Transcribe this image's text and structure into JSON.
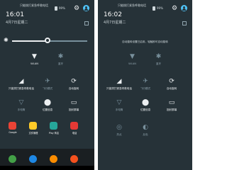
{
  "left": {
    "status_text": "只能拨打紧急呼救电话",
    "battery": "99%",
    "time": "16:01",
    "date": "4月7日星期二",
    "brightness_fraction": 0.47,
    "tiles": [
      {
        "label": "WLAN",
        "icon": "▼",
        "dim": false
      },
      {
        "label": "蓝牙",
        "icon": "✱",
        "dim": true
      },
      {
        "label": "只能拨打紧急呼救电话",
        "icon": "◢",
        "dim": false
      },
      {
        "label": "飞行模式",
        "icon": "✈",
        "dim": true
      },
      {
        "label": "自动旋转",
        "icon": "⟳",
        "dim": false
      },
      {
        "label": "手电筒",
        "icon": "▽",
        "dim": true
      },
      {
        "label": "位置信息",
        "icon": "⬤",
        "dim": false
      },
      {
        "label": "投射屏幕",
        "icon": "▭",
        "dim": false
      }
    ],
    "home_apps": [
      {
        "label": "Google",
        "color": "#ea4335"
      },
      {
        "label": "文件管理",
        "color": "#ffca28"
      },
      {
        "label": "Play 商店",
        "color": "#26a69a"
      },
      {
        "label": "电话",
        "color": "#e53935"
      }
    ],
    "dock": [
      "#43a047",
      "#1e88e5",
      "#fb8c00",
      "#f4511e"
    ]
  },
  "right": {
    "status_text": "只能拨打紧急呼救电话",
    "battery": "99%",
    "time": "16:02",
    "date": "4月7日星期二",
    "notice": "自动旋转设置已启用，轻触即可自动旋转",
    "tiles": [
      {
        "label": "WLAN",
        "icon": "▼",
        "dim": true
      },
      {
        "label": "蓝牙",
        "icon": "✱",
        "dim": true
      },
      {
        "label": "只能拨打紧急呼救电话",
        "icon": "◢",
        "dim": false
      },
      {
        "label": "飞行模式",
        "icon": "✈",
        "dim": true
      },
      {
        "label": "自动旋转",
        "icon": "⟳",
        "dim": false
      },
      {
        "label": "手电筒",
        "icon": "▽",
        "dim": true
      },
      {
        "label": "位置信息",
        "icon": "⬤",
        "dim": false
      },
      {
        "label": "投射屏幕",
        "icon": "▭",
        "dim": false
      },
      {
        "label": "热点",
        "icon": "◎",
        "dim": true
      },
      {
        "label": "反色",
        "icon": "◐",
        "dim": true
      }
    ]
  },
  "icons": {
    "settings": "gear-icon",
    "user": "user-icon",
    "brightness": "sun-icon"
  }
}
